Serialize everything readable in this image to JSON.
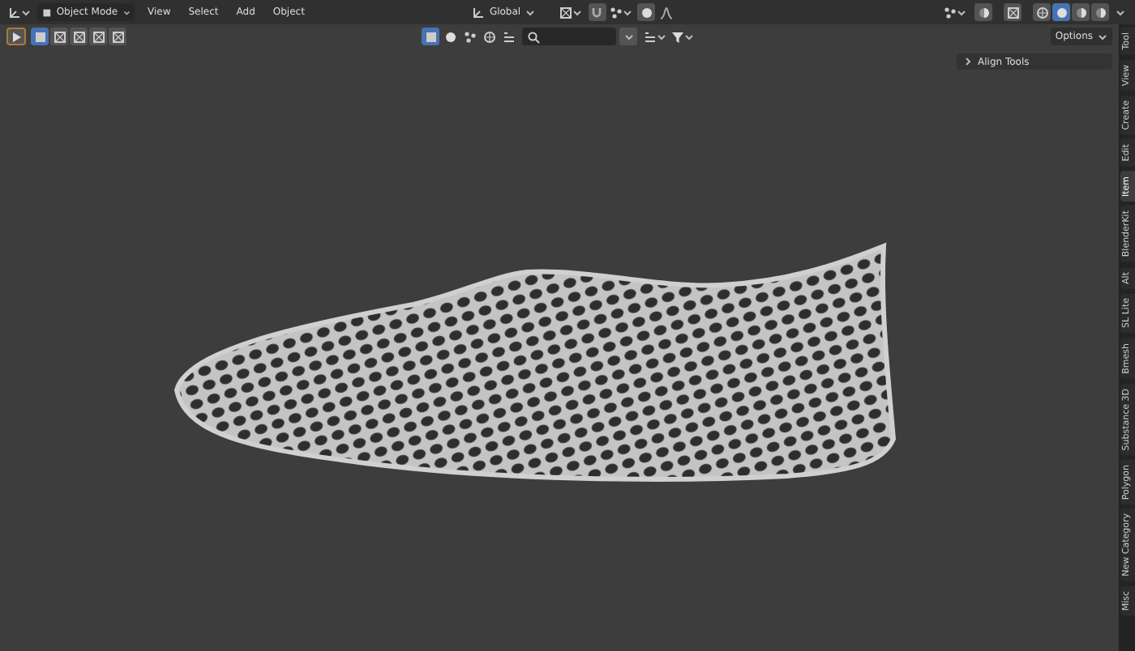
{
  "header": {
    "mode": "Object Mode",
    "menus": [
      "View",
      "Select",
      "Add",
      "Object"
    ],
    "orientation": "Global"
  },
  "tool_settings": {
    "select_modes": [
      {
        "selected": true
      },
      {
        "selected": false
      },
      {
        "selected": false
      },
      {
        "selected": false
      },
      {
        "selected": false
      }
    ],
    "options": "Options"
  },
  "shading_modes": [
    {
      "selected": false
    },
    {
      "selected": true
    },
    {
      "selected": false
    },
    {
      "selected": false
    }
  ],
  "sidebar": {
    "panel": {
      "title": "Align Tools",
      "expanded": false
    },
    "tabs": [
      {
        "label": "Tool",
        "selected": false
      },
      {
        "label": "View",
        "selected": false
      },
      {
        "label": "Create",
        "selected": false
      },
      {
        "label": "Edit",
        "selected": false
      },
      {
        "label": "Item",
        "selected": true
      },
      {
        "label": "BlenderKit",
        "selected": false
      },
      {
        "label": "Alt",
        "selected": false
      },
      {
        "label": "SL Lite",
        "selected": false
      },
      {
        "label": "Bmesh",
        "selected": false
      },
      {
        "label": "Substance 3D",
        "selected": false
      },
      {
        "label": "Polygon",
        "selected": false
      },
      {
        "label": "New Category",
        "selected": false
      },
      {
        "label": "Misc",
        "selected": false
      }
    ]
  }
}
